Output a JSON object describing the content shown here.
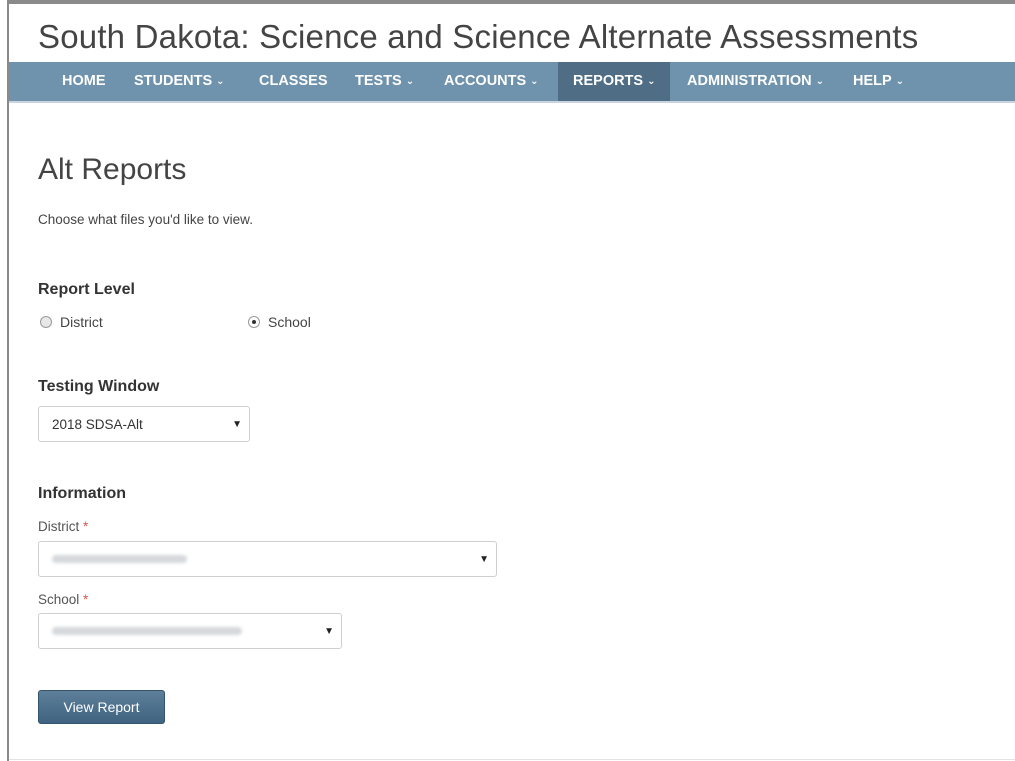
{
  "app": {
    "title": "South Dakota: Science and Science Alternate Assessments"
  },
  "nav": {
    "items": [
      {
        "label": "HOME",
        "chevron": false,
        "active": false
      },
      {
        "label": "STUDENTS",
        "chevron": true,
        "active": false
      },
      {
        "label": "CLASSES",
        "chevron": false,
        "active": false
      },
      {
        "label": "TESTS",
        "chevron": true,
        "active": false
      },
      {
        "label": "ACCOUNTS",
        "chevron": true,
        "active": false
      },
      {
        "label": "REPORTS",
        "chevron": true,
        "active": true
      },
      {
        "label": "ADMINISTRATION",
        "chevron": true,
        "active": false
      },
      {
        "label": "HELP",
        "chevron": true,
        "active": false
      }
    ],
    "chevron_glyph": "⌄"
  },
  "page": {
    "heading": "Alt Reports",
    "intro": "Choose what files you'd like to view."
  },
  "report_level": {
    "label": "Report Level",
    "options": [
      {
        "label": "District",
        "checked": false
      },
      {
        "label": "School",
        "checked": true
      }
    ]
  },
  "testing_window": {
    "label": "Testing Window",
    "selected": "2018 SDSA-Alt"
  },
  "information": {
    "label": "Information",
    "district_label": "District",
    "school_label": "School",
    "required_mark": "*",
    "district_value_redacted": true,
    "school_value_redacted": true
  },
  "actions": {
    "view_report": "View Report"
  },
  "colors": {
    "navbar": "#6f93ad",
    "nav_active": "#4f6e86",
    "button": "#4a6d89",
    "required": "#d9534f"
  },
  "icons": {
    "dropdown_caret": "caret-down-icon",
    "nav_chevron": "chevron-down-icon"
  }
}
